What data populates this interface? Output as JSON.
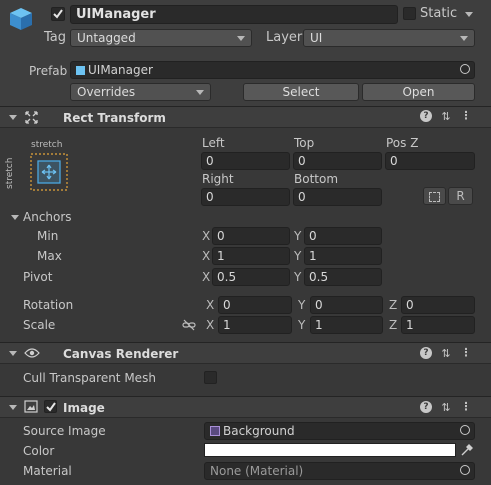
{
  "object": {
    "name": "UIManager",
    "static_label": "Static",
    "tag_label": "Tag",
    "tag_value": "Untagged",
    "layer_label": "Layer",
    "layer_value": "UI",
    "prefab_label": "Prefab",
    "prefab_value": "UIManager",
    "overrides_label": "Overrides",
    "select_label": "Select",
    "open_label": "Open"
  },
  "rect_transform": {
    "title": "Rect Transform",
    "anchor_preset_top": "stretch",
    "anchor_preset_side": "stretch",
    "left_label": "Left",
    "left_value": "0",
    "top_label": "Top",
    "top_value": "0",
    "posz_label": "Pos Z",
    "posz_value": "0",
    "right_label": "Right",
    "right_value": "0",
    "bottom_label": "Bottom",
    "bottom_value": "0",
    "r_button": "R",
    "anchors_label": "Anchors",
    "min_label": "Min",
    "min_x": "0",
    "min_y": "0",
    "max_label": "Max",
    "max_x": "1",
    "max_y": "1",
    "pivot_label": "Pivot",
    "pivot_x": "0.5",
    "pivot_y": "0.5",
    "rotation_label": "Rotation",
    "rot_x": "0",
    "rot_y": "0",
    "rot_z": "0",
    "scale_label": "Scale",
    "scale_x": "1",
    "scale_y": "1",
    "scale_z": "1",
    "x": "X",
    "y": "Y",
    "z": "Z"
  },
  "canvas_renderer": {
    "title": "Canvas Renderer",
    "cull_label": "Cull Transparent Mesh"
  },
  "image": {
    "title": "Image",
    "source_label": "Source Image",
    "source_value": "Background",
    "color_label": "Color",
    "color_value": "#ffffff",
    "material_label": "Material",
    "material_value": "None (Material)"
  },
  "colors": {
    "accent_blue": "#4aa8e0",
    "anchor_orange": "#e3a43a"
  }
}
